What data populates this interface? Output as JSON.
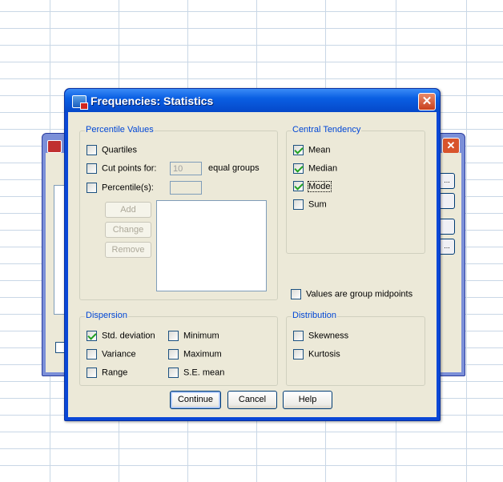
{
  "dialog": {
    "title": "Frequencies: Statistics",
    "close_glyph": "✕"
  },
  "background_dialog": {
    "close_glyph": "✕",
    "button_glyphs": [
      "...",
      "",
      "",
      "..."
    ]
  },
  "percentile_values": {
    "label": "Percentile Values",
    "quartiles": {
      "label": "Quartiles",
      "checked": false
    },
    "cut_points": {
      "label": "Cut points for:",
      "value": "10",
      "suffix": "equal groups",
      "checked": false
    },
    "percentiles": {
      "label": "Percentile(s):",
      "value": "",
      "checked": false
    },
    "add_label": "Add",
    "change_label": "Change",
    "remove_label": "Remove"
  },
  "central_tendency": {
    "label": "Central Tendency",
    "mean": {
      "label": "Mean",
      "checked": true
    },
    "median": {
      "label": "Median",
      "checked": true
    },
    "mode": {
      "label": "Mode",
      "checked": true
    },
    "sum": {
      "label": "Sum",
      "checked": false
    }
  },
  "group_midpoints": {
    "label": "Values are group midpoints",
    "checked": false
  },
  "dispersion": {
    "label": "Dispersion",
    "std_deviation": {
      "label": "Std. deviation",
      "checked": true
    },
    "minimum": {
      "label": "Minimum",
      "checked": false
    },
    "variance": {
      "label": "Variance",
      "checked": false
    },
    "maximum": {
      "label": "Maximum",
      "checked": false
    },
    "range": {
      "label": "Range",
      "checked": false
    },
    "se_mean": {
      "label": "S.E. mean",
      "checked": false
    }
  },
  "distribution": {
    "label": "Distribution",
    "skewness": {
      "label": "Skewness",
      "checked": false
    },
    "kurtosis": {
      "label": "Kurtosis",
      "checked": false
    }
  },
  "buttons": {
    "continue_label": "Continue",
    "cancel_label": "Cancel",
    "help_label": "Help"
  },
  "colors": {
    "titlebar": "#0a5fe3",
    "client": "#ece9d8",
    "group_label": "#0046d5",
    "check": "#21a121"
  }
}
